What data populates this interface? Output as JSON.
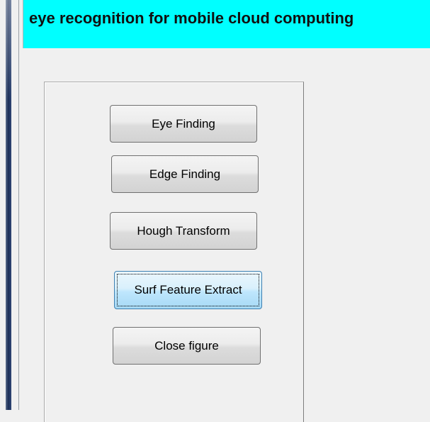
{
  "title": "eye recognition for mobile cloud computing",
  "buttons": {
    "eye_finding": "Eye Finding",
    "edge_finding": "Edge Finding",
    "hough_transform": "Hough Transform",
    "surf_feature_extract": "Surf Feature Extract",
    "close_figure": "Close figure"
  },
  "colors": {
    "banner": "#00ffff",
    "background": "#f0f0f0",
    "focused_button": "#bee6fd"
  }
}
